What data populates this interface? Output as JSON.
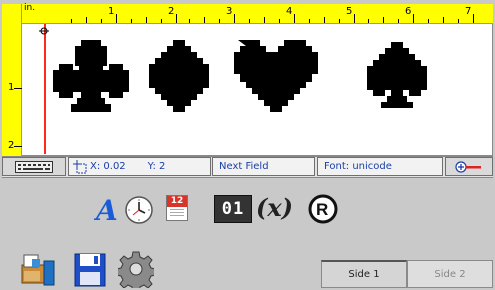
{
  "ruler": {
    "unit": "in.",
    "h_ticks": [
      "1",
      "2",
      "3",
      "4",
      "5",
      "6",
      "7"
    ],
    "v_ticks": [
      "1",
      "2"
    ]
  },
  "canvas": {
    "symbols": [
      "club",
      "diamond",
      "heart",
      "spade"
    ]
  },
  "status": {
    "x_label": "X: 0.02",
    "y_label": "Y: 2",
    "next_field": "Next Field",
    "font": "Font: unicode"
  },
  "toolbar": {
    "icons": [
      "text-A-icon",
      "clock-icon",
      "calendar-icon",
      "counter-icon",
      "variable-x-icon",
      "registered-icon"
    ],
    "variable_label": "(x)",
    "calendar_day": "12",
    "counter_value": "01"
  },
  "bottom": {
    "icons": [
      "file-open-icon",
      "save-icon",
      "gear-icon"
    ],
    "tabs": [
      "Side 1",
      "Side 2"
    ]
  },
  "colors": {
    "ruler": "#ffff00",
    "accent_blue": "#1a3ea8",
    "margin_red": "#ff2a1a"
  }
}
